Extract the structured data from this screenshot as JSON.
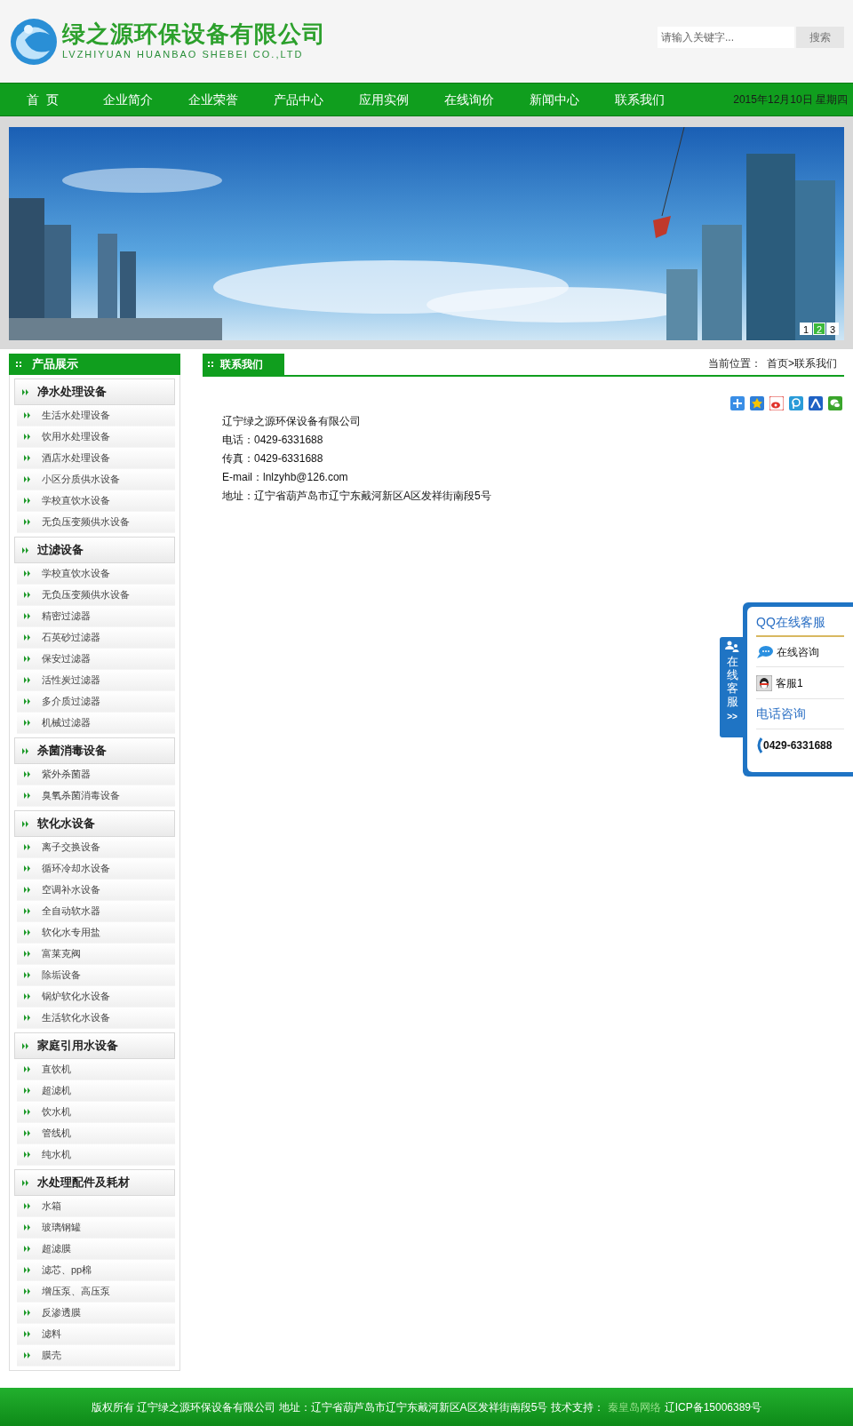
{
  "header": {
    "logo_title": "绿之源环保设备有限公司",
    "logo_subtitle": "LVZHIYUAN HUANBAO SHEBEI CO.,LTD",
    "search": {
      "placeholder": "请输入关键字...",
      "button": "搜索"
    }
  },
  "nav": {
    "items": [
      {
        "label": "首  页",
        "selected": false
      },
      {
        "label": "企业简介",
        "selected": false
      },
      {
        "label": "企业荣誉",
        "selected": false
      },
      {
        "label": "产品中心",
        "selected": false
      },
      {
        "label": "应用实例",
        "selected": false
      },
      {
        "label": "在线询价",
        "selected": false
      },
      {
        "label": "新闻中心",
        "selected": false
      },
      {
        "label": "联系我们",
        "selected": false
      }
    ],
    "date": "2015年12月10日 星期四"
  },
  "banner": {
    "kind": "picture",
    "pages": [
      {
        "label": "1",
        "selected": false
      },
      {
        "label": "2",
        "selected": true
      },
      {
        "label": "3",
        "selected": false
      }
    ]
  },
  "sidebar": {
    "title": "产品展示",
    "categories": [
      {
        "name": "净水处理设备",
        "items": [
          "生活水处理设备",
          "饮用水处理设备",
          "酒店水处理设备",
          "小区分质供水设备",
          "学校直饮水设备",
          "无负压变频供水设备"
        ]
      },
      {
        "name": "过滤设备",
        "items": [
          "学校直饮水设备",
          "无负压变频供水设备",
          "精密过滤器",
          "石英砂过滤器",
          "保安过滤器",
          "活性炭过滤器",
          "多介质过滤器",
          "机械过滤器"
        ]
      },
      {
        "name": "杀菌消毒设备",
        "items": [
          "紫外杀菌器",
          "臭氧杀菌消毒设备"
        ]
      },
      {
        "name": "软化水设备",
        "items": [
          "离子交换设备",
          "循环冷却水设备",
          "空调补水设备",
          "全自动软水器",
          "软化水专用盐",
          "富莱克阀",
          "除垢设备",
          "锅炉软化水设备",
          "生活软化水设备"
        ]
      },
      {
        "name": "家庭引用水设备",
        "items": [
          "直饮机",
          "超滤机",
          "饮水机",
          "管线机",
          "纯水机"
        ]
      },
      {
        "name": "水处理配件及耗材",
        "items": [
          "水箱",
          "玻璃钢罐",
          "超滤膜",
          "滤芯、pp棉",
          "增压泵、高压泵",
          "反渗透膜",
          "滤料",
          "膜壳"
        ]
      }
    ]
  },
  "content": {
    "title": "联系我们",
    "breadcrumb_label": "当前位置：",
    "breadcrumb": "首页>联系我们",
    "lines": [
      "辽宁绿之源环保设备有限公司",
      "电话：0429-6331688",
      "传真：0429-6331688",
      "E-mail：lnlzyhb@126.com",
      "地址：辽宁省葫芦岛市辽宁东戴河新区A区发祥街南段5号"
    ]
  },
  "service_panel": {
    "tab": "在线客服",
    "tab_arrow": ">>",
    "title": "QQ在线客服",
    "online": "在线咨询",
    "agent": "客服1",
    "phone_title": "电话咨询",
    "phone": "0429-6331688"
  },
  "footer": {
    "text": "版权所有 辽宁绿之源环保设备有限公司 地址：辽宁省葫芦岛市辽宁东戴河新区A区发祥街南段5号 技术支持：",
    "link": "秦皇岛网络",
    "icp": "辽ICP备15006389号"
  }
}
